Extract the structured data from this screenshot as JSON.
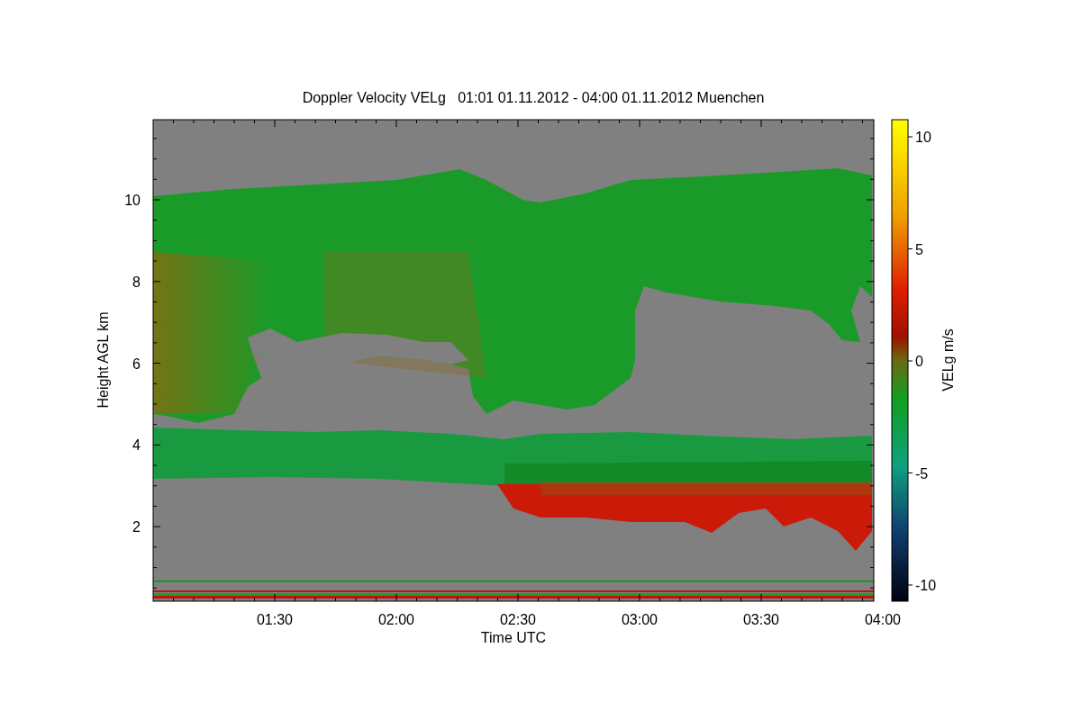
{
  "title": "Doppler Velocity VELg   01:01 01.11.2012 - 04:00 01.11.2012 Muenchen",
  "y_axis": {
    "label": "Height AGL km",
    "ticks": [
      "10",
      "8",
      "6",
      "4",
      "2"
    ]
  },
  "x_axis": {
    "label": "Time UTC",
    "ticks": [
      "01:30",
      "02:00",
      "02:30",
      "03:00",
      "03:30",
      "04:00"
    ]
  },
  "colorbar": {
    "label": "VELg m/s",
    "ticks": [
      "10",
      "5",
      "0",
      "-5",
      "-10"
    ]
  }
}
